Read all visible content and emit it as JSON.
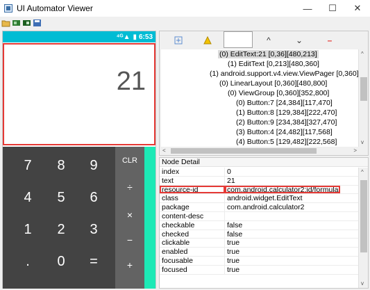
{
  "window": {
    "title": "UI Automator Viewer",
    "minimize": "—",
    "maximize": "☐",
    "close": "✕"
  },
  "toolbar": {
    "icons": [
      "open-folder-icon",
      "device-screenshot-icon",
      "device-screenshot-compressed-icon",
      "save-icon"
    ]
  },
  "device": {
    "status_time": "6:53",
    "display_value": "21",
    "keys": [
      [
        "7",
        "8",
        "9"
      ],
      [
        "4",
        "5",
        "6"
      ],
      [
        "1",
        "2",
        "3"
      ],
      [
        ".",
        "0",
        "="
      ]
    ],
    "ops": [
      "CLR",
      "÷",
      "×",
      "−",
      "+"
    ]
  },
  "tree_toolbar": {
    "icons": [
      "expand-all-icon",
      "warning-icon",
      "search-box",
      "prev-icon",
      "next-icon",
      "clear-icon"
    ],
    "up": "^",
    "down": "⌄",
    "minus": "–"
  },
  "tree": [
    {
      "text": "(0) EditText:21 [0,36][480,213]",
      "indent": 82,
      "selected": true
    },
    {
      "text": "(1) EditText [0,213][480,360]",
      "indent": 96
    },
    {
      "text": "(1) android.support.v4.view.ViewPager [0,360][4",
      "indent": 70
    },
    {
      "text": "(0) LinearLayout [0,360][480,800]",
      "indent": 84
    },
    {
      "text": "(0) ViewGroup [0,360][352,800]",
      "indent": 96
    },
    {
      "text": "(0) Button:7 [24,384][117,470]",
      "indent": 108
    },
    {
      "text": "(1) Button:8 [129,384][222,470]",
      "indent": 108
    },
    {
      "text": "(2) Button:9 [234,384][327,470]",
      "indent": 108
    },
    {
      "text": "(3) Button:4 [24,482][117,568]",
      "indent": 108
    },
    {
      "text": "(4) Button:5 [129,482][222,568]",
      "indent": 108
    }
  ],
  "node_detail": {
    "header": "Node Detail",
    "rows": [
      {
        "key": "index",
        "value": "0"
      },
      {
        "key": "text",
        "value": "21"
      },
      {
        "key": "resource-id",
        "value": "com.android.calculator2:id/formula",
        "highlight": true
      },
      {
        "key": "class",
        "value": "android.widget.EditText"
      },
      {
        "key": "package",
        "value": "com.android.calculator2"
      },
      {
        "key": "content-desc",
        "value": ""
      },
      {
        "key": "checkable",
        "value": "false"
      },
      {
        "key": "checked",
        "value": "false"
      },
      {
        "key": "clickable",
        "value": "true"
      },
      {
        "key": "enabled",
        "value": "true"
      },
      {
        "key": "focusable",
        "value": "true"
      },
      {
        "key": "focused",
        "value": "true"
      }
    ]
  },
  "colors": {
    "status_bar": "#00bcd4",
    "keypad": "#434343",
    "ops": "#636363",
    "accent": "#1de9b6",
    "highlight": "#e53935"
  }
}
